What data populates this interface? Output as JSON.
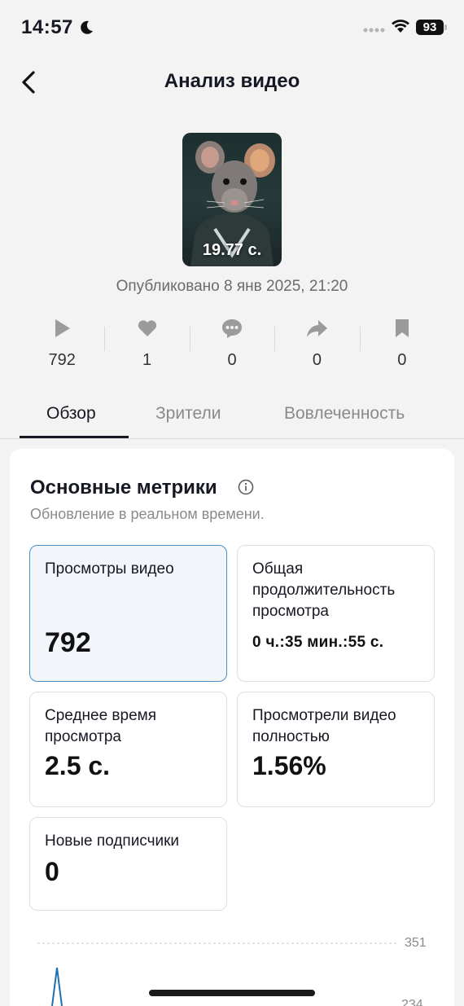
{
  "status_bar": {
    "time": "14:57",
    "battery": "93"
  },
  "header": {
    "title": "Анализ видео"
  },
  "video": {
    "duration": "19.77 с.",
    "published": "Опубликовано 8 янв 2025, 21:20"
  },
  "stats": [
    {
      "icon": "play-icon",
      "value": "792"
    },
    {
      "icon": "heart-icon",
      "value": "1"
    },
    {
      "icon": "comment-icon",
      "value": "0"
    },
    {
      "icon": "share-icon",
      "value": "0"
    },
    {
      "icon": "bookmark-icon",
      "value": "0"
    }
  ],
  "tabs": [
    {
      "label": "Обзор",
      "active": true
    },
    {
      "label": "Зрители",
      "active": false
    },
    {
      "label": "Вовлеченность",
      "active": false
    }
  ],
  "metrics_section": {
    "title": "Основные метрики",
    "subtitle": "Обновление в реальном времени.",
    "cards": [
      {
        "label": "Просмотры видео",
        "value": "792",
        "selected": true
      },
      {
        "label": "Общая продолжительность просмотра",
        "value": "0 ч.:35 мин.:55 с."
      },
      {
        "label": "Среднее время просмотра",
        "value": "2.5 с."
      },
      {
        "label": "Просмотрели видео полностью",
        "value": "1.56%"
      },
      {
        "label": "Новые подписчики",
        "value": "0"
      }
    ]
  },
  "chart_data": {
    "type": "line",
    "y_ticks": [
      "351",
      "234"
    ]
  },
  "colors": {
    "accent_border": "#4a90c8",
    "selected_bg": "#f2f6fb",
    "chart_line": "#1f6fb2"
  }
}
